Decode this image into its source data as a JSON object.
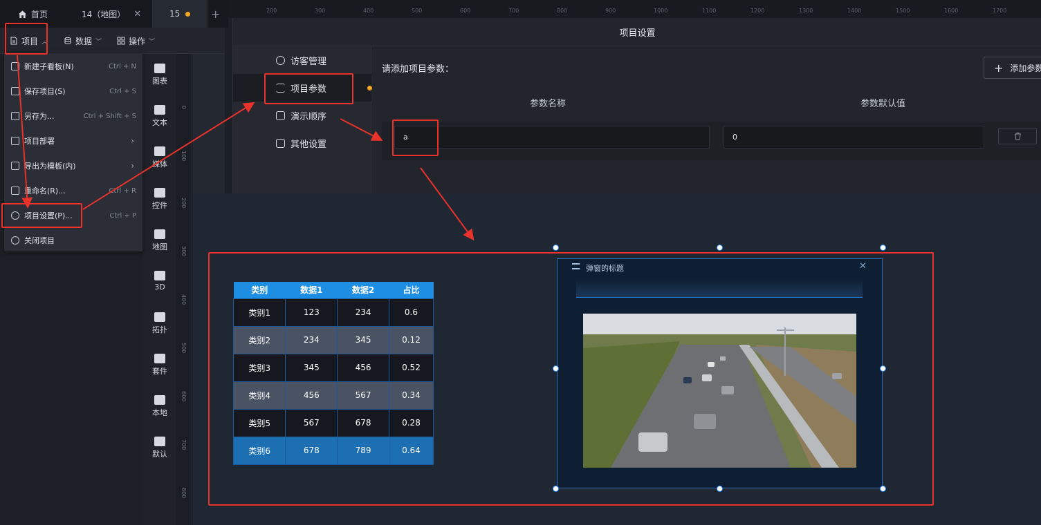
{
  "tabs": [
    {
      "label": "首页",
      "icon": "home-icon"
    },
    {
      "label": "14（地图）",
      "close": "✕"
    },
    {
      "label": "15",
      "modified": true
    }
  ],
  "toolbar": {
    "project": "项目",
    "data": "数据",
    "operate": "操作"
  },
  "menu": {
    "items": [
      {
        "label": "新建子看板(N)",
        "shortcut": "Ctrl + N",
        "icon": "board-icon"
      },
      {
        "label": "保存项目(S)",
        "shortcut": "Ctrl + S",
        "icon": "save-icon"
      },
      {
        "label": "另存为...",
        "shortcut": "Ctrl + Shift + S",
        "icon": "save-as-icon"
      },
      {
        "label": "项目部署",
        "shortcut": "",
        "icon": "deploy-icon",
        "submenu": true
      },
      {
        "label": "导出为模板(内)",
        "shortcut": "",
        "icon": "export-icon",
        "submenu": true
      },
      {
        "label": "重命名(R)...",
        "shortcut": "Ctrl + R",
        "icon": "rename-icon"
      },
      {
        "label": "项目设置(P)...",
        "shortcut": "Ctrl + P",
        "icon": "gear-icon"
      },
      {
        "label": "关闭项目",
        "shortcut": "",
        "icon": "close-circle-icon"
      }
    ]
  },
  "components": [
    "图表",
    "文本",
    "媒体",
    "控件",
    "地图",
    "3D",
    "拓扑",
    "套件",
    "本地",
    "默认"
  ],
  "ruler_v": [
    "0",
    "100",
    "200",
    "300",
    "400",
    "500",
    "600",
    "700",
    "800"
  ],
  "ruler_h": [
    "200",
    "300",
    "400",
    "500",
    "600",
    "700",
    "800",
    "900",
    "1000",
    "1100",
    "1200",
    "1300",
    "1400",
    "1500",
    "1600",
    "1700"
  ],
  "dialog": {
    "title": "项目设置",
    "nav": [
      {
        "label": "访客管理",
        "icon": "users-icon"
      },
      {
        "label": "项目参数",
        "icon": "sliders-icon",
        "selected": true
      },
      {
        "label": "演示顺序",
        "icon": "presentation-icon"
      },
      {
        "label": "其他设置",
        "icon": "lock-icon"
      }
    ],
    "prompt": "请添加项目参数：",
    "add_button": "添加参数",
    "col_name": "参数名称",
    "col_default": "参数默认值",
    "param_name": "a",
    "param_default": "0"
  },
  "table": {
    "headers": [
      "类别",
      "数据1",
      "数据2",
      "占比"
    ],
    "rows": [
      [
        "类别1",
        "123",
        "234",
        "0.6"
      ],
      [
        "类别2",
        "234",
        "345",
        "0.12"
      ],
      [
        "类别3",
        "345",
        "456",
        "0.52"
      ],
      [
        "类别4",
        "456",
        "567",
        "0.34"
      ],
      [
        "类别5",
        "567",
        "678",
        "0.28"
      ],
      [
        "类别6",
        "678",
        "789",
        "0.64"
      ]
    ]
  },
  "popup": {
    "title": "弹窗的标题",
    "close": "✕"
  },
  "colors": {
    "accent": "#1e8ee3",
    "highlight": "#e8322b",
    "modified_dot": "#f5a623"
  }
}
